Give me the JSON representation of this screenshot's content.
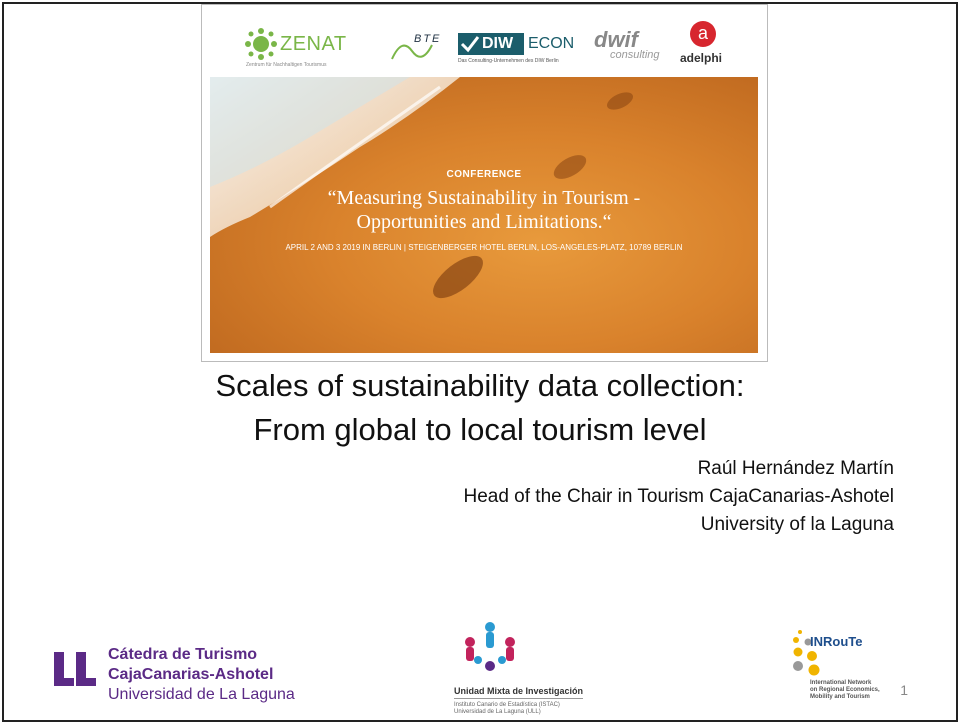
{
  "banner": {
    "logos": {
      "zenat": {
        "name": "ZENAT",
        "sub": "Zentrum für Nachhaltigen Tourismus"
      },
      "bte": {
        "name": "BTE"
      },
      "diw": {
        "part1": "DIW",
        "part2": "ECON",
        "sub": "Das Consulting-Unternehmen des DIW Berlin"
      },
      "dwif": {
        "name": "dwif",
        "sub": "consulting"
      },
      "adelphi": {
        "letter": "a",
        "name": "adelphi"
      }
    },
    "kicker": "CONFERENCE",
    "title_line1": "“Measuring Sustainability in Tourism -",
    "title_line2": "Opportunities and Limitations.“",
    "details": "APRIL 2 AND 3 2019 IN BERLIN  |  STEIGENBERGER HOTEL BERLIN, LOS-ANGELES-PLATZ, 10789 BERLIN"
  },
  "title": {
    "line1": "Scales of sustainability data collection:",
    "line2": "From global to local tourism level"
  },
  "author": {
    "name": "Raúl Hernández Martín",
    "role": "Head of the Chair in Tourism CajaCanarias-Ashotel",
    "affiliation": "University of la Laguna"
  },
  "footer": {
    "catedra": {
      "line1": "Cátedra de Turismo",
      "line2": "CajaCanarias-Ashotel",
      "line3": "Universidad de La Laguna",
      "color": "#5b2a86"
    },
    "unidad": {
      "title": "Unidad Mixta de Investigación",
      "sub1": "Instituto Canario de Estadística (ISTAC)",
      "sub2": "Universidad de La Laguna (ULL)"
    },
    "inroute": {
      "name": "INRouTe",
      "sub1": "International Network",
      "sub2": "on Regional Economics,",
      "sub3": "Mobility and Tourism"
    }
  },
  "page_number": "1",
  "colors": {
    "accent_purple": "#5b2a86",
    "zenat_green": "#7ab648",
    "diw_teal": "#1b5d6b",
    "adelphi_red": "#d7262e",
    "inroute_yellow": "#f0b400"
  }
}
